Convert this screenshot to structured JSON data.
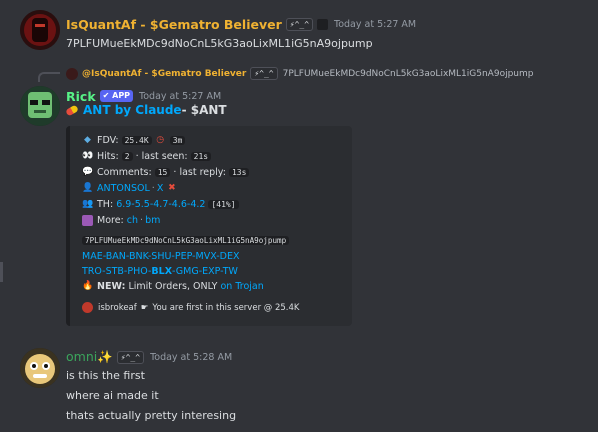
{
  "colors": {
    "bg": "#313338",
    "embed_bg": "#2b2d31",
    "name_quant": "#f0b232",
    "name_rick": "#57f287",
    "name_omni": "#3ba55c",
    "link": "#00a8fc",
    "app": "#5865f2"
  },
  "messages": {
    "m1": {
      "username": "IsQuantAf - $Gematro Believer",
      "tag": "⚡^_^",
      "time": "Today at 5:27 AM",
      "content": "7PLFUMueEkMDc9dNoCnL5kG3aoLixML1iG5nA9ojpump"
    },
    "reply": {
      "username": "@IsQuantAf - $Gematro Believer",
      "tag": "⚡^_^",
      "content": "7PLFUMueEkMDc9dNoCnL5kG3aoLixML1iG5nA9ojpump"
    },
    "m2": {
      "username": "Rick",
      "app_badge": "✔ APP",
      "time": "Today at 5:27 AM",
      "title_link": "ANT by Claude",
      "title_rest": " - $ANT",
      "embed": {
        "fdv_label": "FDV:",
        "fdv_value": "25.4K",
        "age": "3m",
        "hits_label": "Hits:",
        "hits_value": "2",
        "last_seen_label": "· last seen:",
        "last_seen_value": "21s",
        "comments_label": "Comments:",
        "comments_value": "15",
        "last_reply_label": "· last reply:",
        "last_reply_value": "13s",
        "dev_link": "ANTONSOL",
        "dev_sep": "·",
        "dev_x": "X",
        "th_label": "TH:",
        "th_values": "6.9-5.5-4.7-4.6-4.2",
        "th_pct": "[41%]",
        "more_label": "More:",
        "more_ch": "ch",
        "more_dot": "·",
        "more_bm": "bm",
        "address": "7PLFUMueEkMDc9dNoCnL5kG3aoLixML1iG5nA9ojpump",
        "links_row1": "MAE-BAN-BNK-SHU-PEP-MVX-DEX",
        "links_row2_a": "TRO-STB-PHO-",
        "links_row2_b": "BLX",
        "links_row2_c": "-GMG-EXP-TW",
        "new_label": "NEW:",
        "new_text": "Limit Orders, ONLY",
        "new_link": "on Trojan",
        "footer_user": "isbrokeaf",
        "footer_text": "You are first in this server @ 25.4K"
      }
    },
    "m3": {
      "username": "omni✨",
      "tag": "⚡^_^",
      "time": "Today at 5:28 AM",
      "lines": [
        "is this the first",
        "where ai made it",
        "thats actually pretty interesing"
      ]
    }
  }
}
